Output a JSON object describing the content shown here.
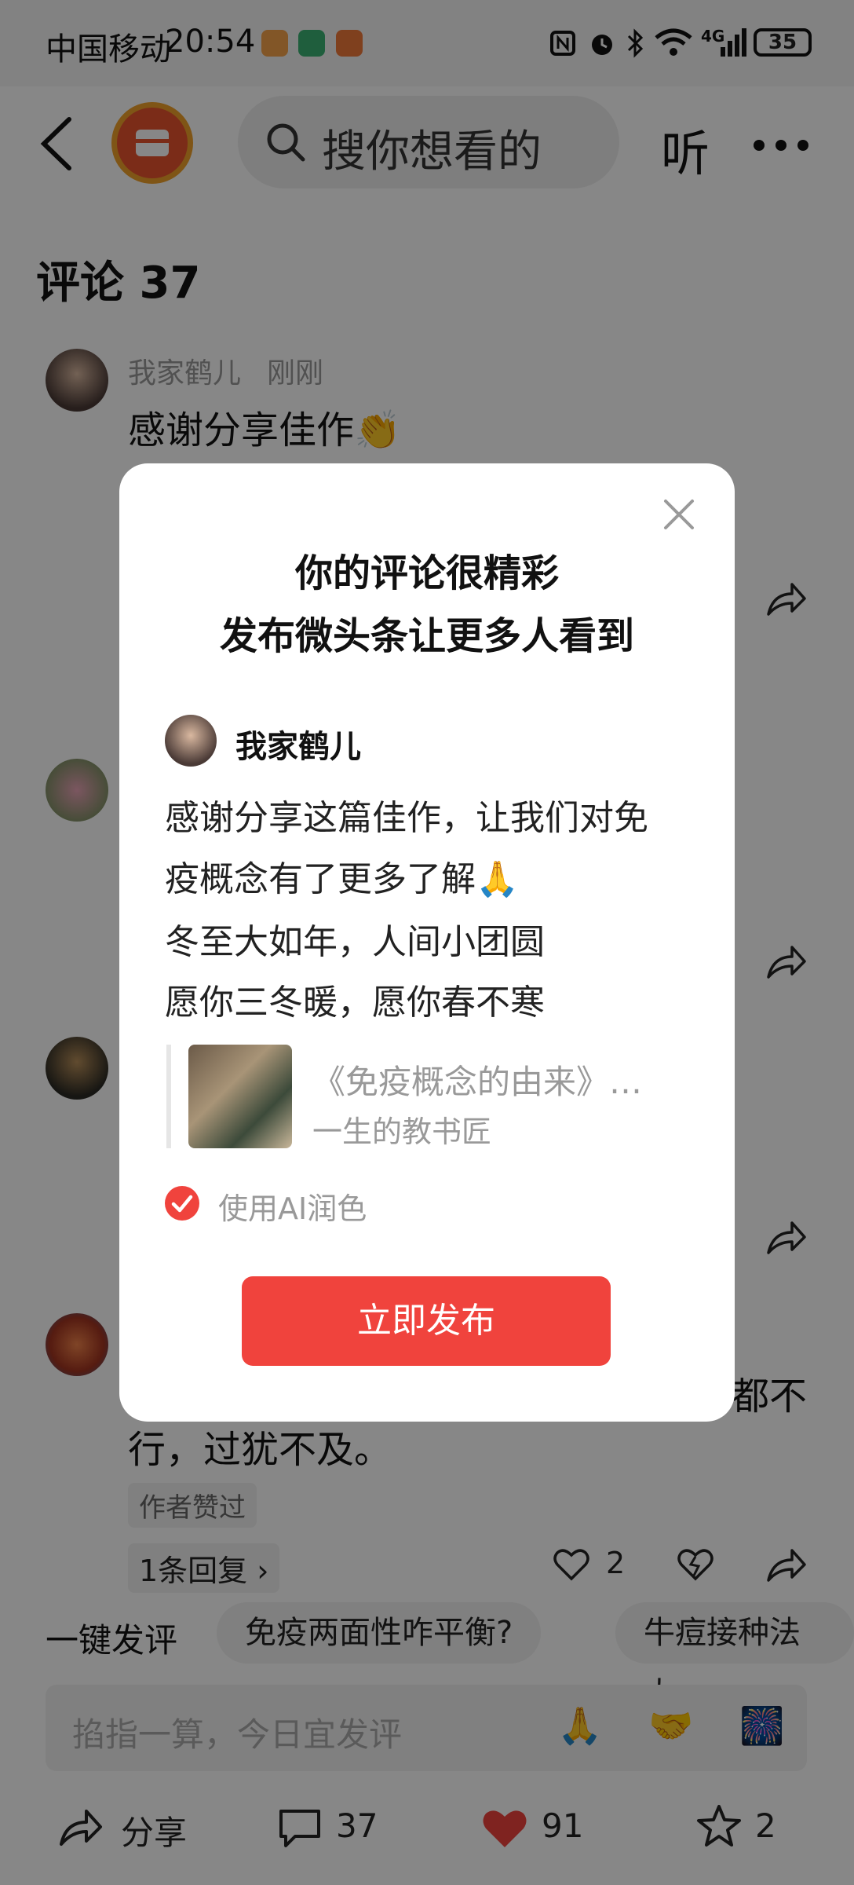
{
  "status_bar": {
    "carrier": "中国移动",
    "time": "20:54",
    "network": "4G",
    "battery": "35"
  },
  "header": {
    "search_placeholder": "搜你想看的",
    "listen_label": "听"
  },
  "comments_title": "评论 37",
  "comments": [
    {
      "user": "我家鹤儿",
      "time": "刚刚",
      "text": "感谢分享佳作👏"
    },
    {
      "text_partial": "都不",
      "text_line2": "行，过犹不及。",
      "badge": "作者赞过",
      "replies": "1条回复 ›",
      "likes": "2"
    }
  ],
  "quick_bar": {
    "label": "一键发评",
    "chips": [
      "免疫两面性咋平衡?",
      "牛痘接种法太"
    ]
  },
  "comment_input": {
    "placeholder": "掐指一算，今日宜发评"
  },
  "bottom_bar": {
    "share": "分享",
    "comments": "37",
    "likes": "91",
    "favorites": "2"
  },
  "dialog": {
    "title_line1": "你的评论很精彩",
    "title_line2": "发布微头条让更多人看到",
    "user_name": "我家鹤儿",
    "body_lines": [
      "感谢分享这篇佳作，让我们对免",
      "疫概念有了更多了解🙏",
      "冬至大如年，人间小团圆",
      "愿你三冬暖，愿你春不寒"
    ],
    "article_title": "《免疫概念的由来》…",
    "article_author": "一生的教书匠",
    "ai_polish_label": "使用AI润色",
    "ai_polish_checked": true,
    "publish_label": "立即发布"
  },
  "colors": {
    "accent": "#f0433d",
    "overlay": "rgba(0,0,0,0.47)"
  }
}
